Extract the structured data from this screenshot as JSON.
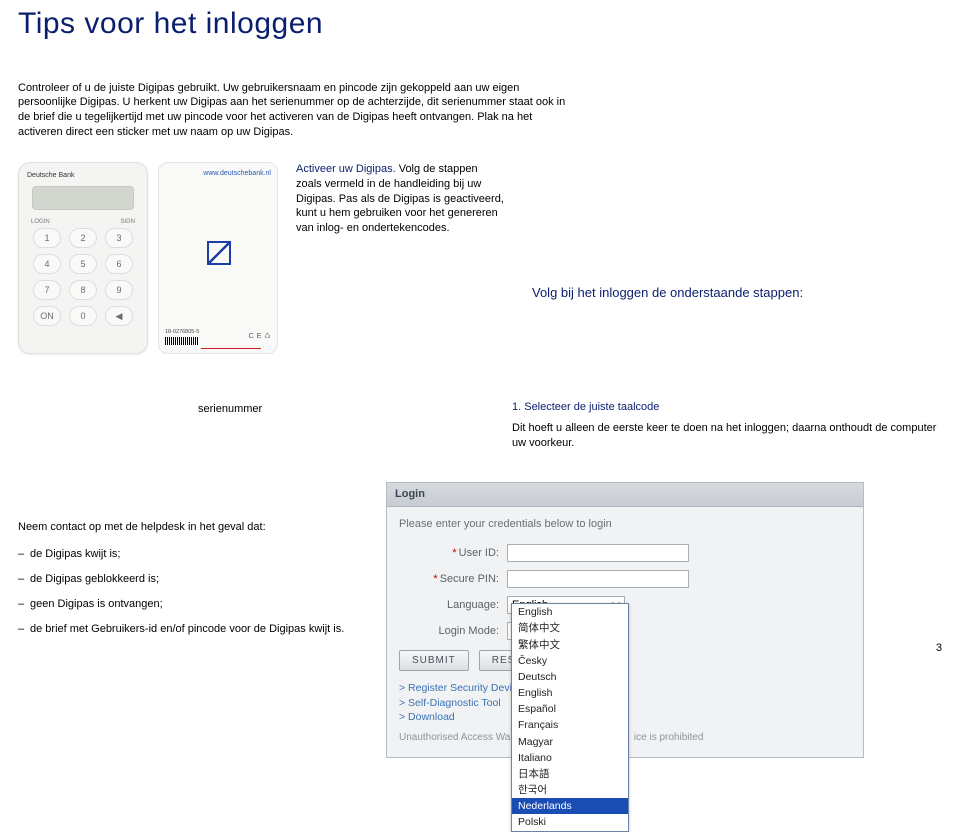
{
  "title": "Tips voor het inloggen",
  "intro": {
    "p1": "Controleer of u de juiste Digipas gebruikt. Uw gebruikersnaam en pincode zijn gekoppeld aan uw eigen persoonlijke Digipas. U herkent uw Digipas aan het serienummer op de achterzijde, dit serienummer staat ook in de brief die u tegelijkertijd met uw pincode voor het activeren van de Digipas heeft ontvangen. Plak na het activeren direct een sticker met uw naam op uw Digipas."
  },
  "device": {
    "brand": "Deutsche Bank",
    "url": "www.deutschebank.nl",
    "topleft": "LOGIN",
    "topright": "SIGN",
    "keys": [
      "1",
      "2",
      "3",
      "4",
      "5",
      "6",
      "7",
      "8",
      "9",
      "ON",
      "0",
      "◀"
    ],
    "serial": "18-0276805-5",
    "ce": "C E ♺"
  },
  "activate": {
    "lead": "Activeer uw Digipas.",
    "rest": " Volg de stappen zoals vermeld in de handleiding bij uw Digipas. Pas als de Digipas is geactiveerd, kunt u hem gebruiken voor het genereren van inlog- en ondertekencodes."
  },
  "steps_heading": "Volg bij het inloggen de onderstaande stappen:",
  "serial_pointer_label": "serienummer",
  "step1": {
    "heading": "1. Selecteer de juiste taalcode",
    "body": "Dit hoeft u alleen de eerste keer te doen na het inloggen; daarna onthoudt de computer uw voorkeur."
  },
  "helpdesk": {
    "intro": "Neem contact op met de helpdesk in het geval dat:",
    "items": [
      "de Digipas kwijt is;",
      "de Digipas geblokkeerd is;",
      "geen Digipas is ontvangen;",
      "de brief met Gebruikers-id en/of pincode voor de Digipas kwijt is."
    ]
  },
  "login": {
    "title": "Login",
    "hint": "Please enter your credentials below to login",
    "labels": {
      "user": "User ID:",
      "pin": "Secure PIN:",
      "lang": "Language:",
      "mode": "Login Mode:"
    },
    "lang_selected": "English",
    "submit": "SUBMIT",
    "reset": "RESET",
    "links": [
      "> Register Security Device",
      "> Self-Diagnostic Tool",
      "> Download"
    ],
    "warn_a": "Unauthorised Access Wa",
    "warn_b": "ice is prohibited",
    "options": [
      "English",
      "简体中文",
      "繁体中文",
      "Česky",
      "Deutsch",
      "English",
      "Español",
      "Français",
      "Magyar",
      "Italiano",
      "日本語",
      "한국어",
      "Nederlands",
      "Polski"
    ],
    "selected_index": 12
  },
  "page_number": "3"
}
